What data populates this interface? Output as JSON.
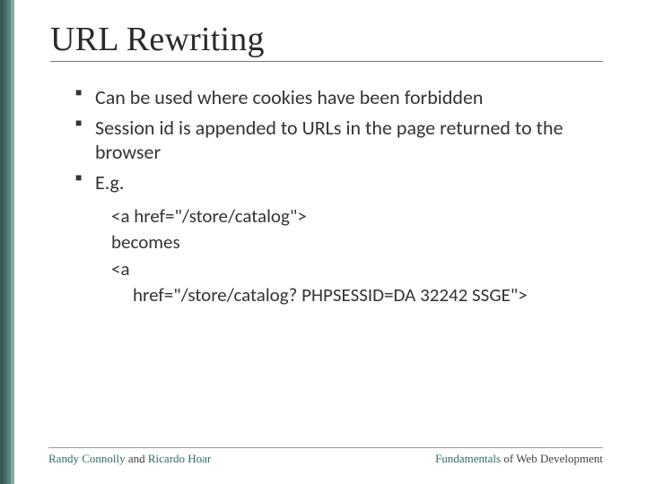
{
  "title": "URL Rewriting",
  "bullets": {
    "b1": "Can be used where cookies have been forbidden",
    "b2": "Session id is appended to URLs in the page returned to the browser",
    "b3": "E.g."
  },
  "code": {
    "line1": "<a href=\"/store/catalog\">",
    "line2": "becomes",
    "line3": "<a",
    "line4": "href=\"/store/catalog? PHPSESSID=DA 32242 SSGE\">"
  },
  "footer": {
    "author1": "Randy Connolly",
    "author_join": " and ",
    "author2": "Ricardo Hoar",
    "book_hl": "Fundamentals",
    "book_rest": " of Web Development"
  }
}
